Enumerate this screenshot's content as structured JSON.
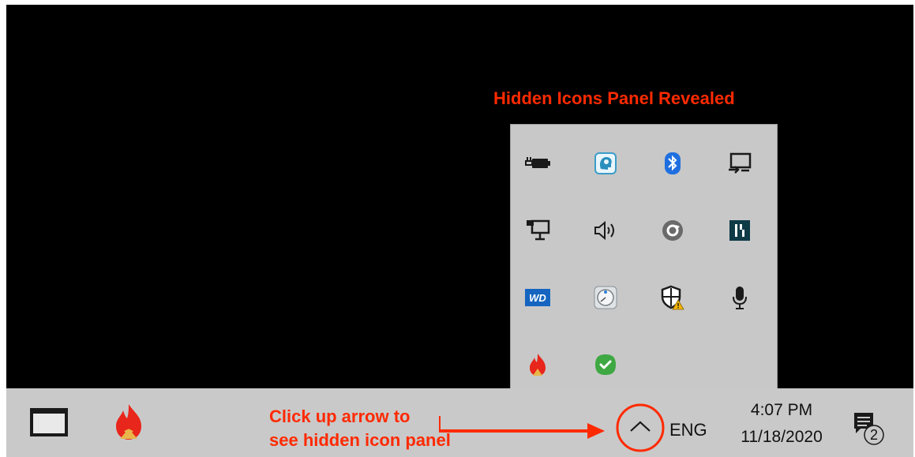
{
  "annotations": {
    "panel_title": "Hidden Icons Panel Revealed",
    "callout_line1": "Click up arrow to",
    "callout_line2": "see hidden icon panel",
    "accent_color": "#ff2a00"
  },
  "hidden_icons": [
    {
      "icon": "power-battery-icon"
    },
    {
      "icon": "app-head-icon"
    },
    {
      "icon": "bluetooth-icon"
    },
    {
      "icon": "project-display-icon"
    },
    {
      "icon": "network-icon"
    },
    {
      "icon": "volume-icon"
    },
    {
      "icon": "sync-app-icon"
    },
    {
      "icon": "app-tile-icon"
    },
    {
      "icon": "wd-icon",
      "text": "WD"
    },
    {
      "icon": "disk-utility-icon"
    },
    {
      "icon": "security-warning-icon"
    },
    {
      "icon": "microphone-icon"
    },
    {
      "icon": "flame-app-icon"
    },
    {
      "icon": "green-check-icon"
    }
  ],
  "taskbar": {
    "language": "ENG",
    "time": "4:07 PM",
    "date": "11/18/2020",
    "notification_count": "2"
  }
}
